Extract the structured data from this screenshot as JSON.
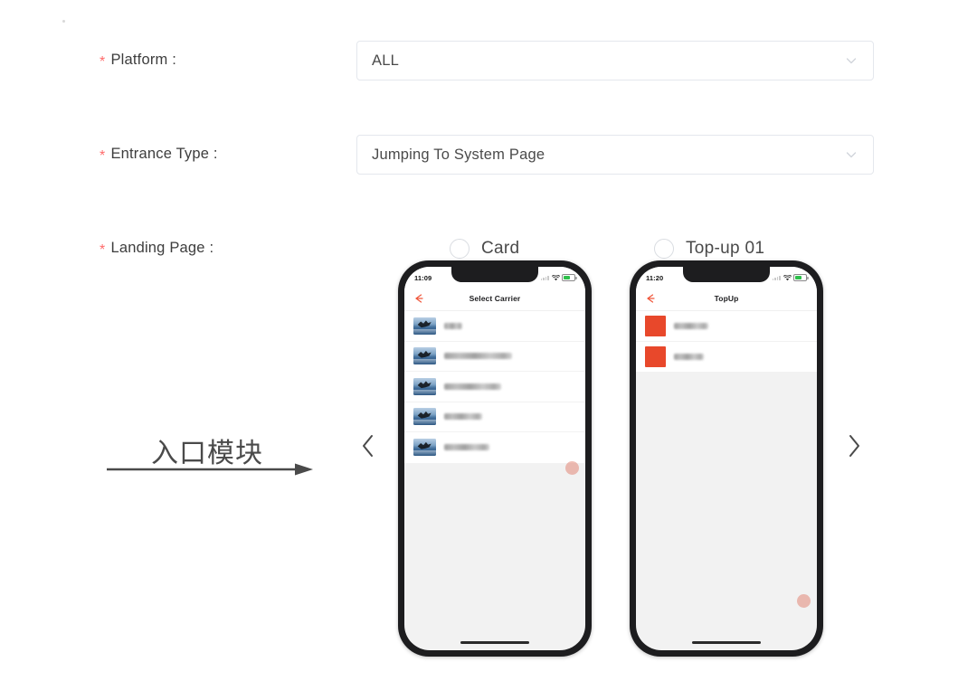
{
  "form": {
    "required_mark": "*",
    "fields": [
      {
        "label": "Platform :",
        "value": "ALL"
      },
      {
        "label": "Entrance Type :",
        "value": "Jumping To System Page"
      },
      {
        "label": "Landing Page :",
        "value": ""
      }
    ]
  },
  "annotation": {
    "text": "入口模块"
  },
  "carousel": {
    "prev_label": "‹",
    "next_label": "›"
  },
  "landing_options": [
    {
      "label": "Card",
      "selected": false,
      "phone": {
        "status_time": "11:09",
        "nav_title": "Select Carrier",
        "rows": [
          {
            "text_width": 20
          },
          {
            "text_width": 75
          },
          {
            "text_width": 63
          },
          {
            "text_width": 42
          },
          {
            "text_width": 50
          }
        ]
      }
    },
    {
      "label": "Top-up 01",
      "selected": false,
      "phone": {
        "status_time": "11:20",
        "nav_title": "TopUp",
        "rows": [
          {
            "text_width": 38
          },
          {
            "text_width": 33
          }
        ]
      }
    }
  ],
  "colors": {
    "required": "#ff6b6b",
    "back_arrow": "#f0563a",
    "thumb_square": "#e8482b",
    "battery": "#2ec04b",
    "border": "#e4e7ed"
  }
}
